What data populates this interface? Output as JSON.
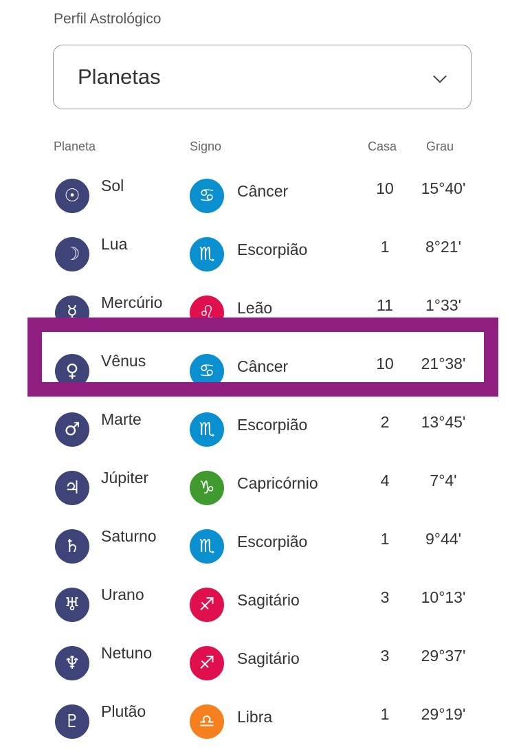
{
  "header": {
    "title": "Perfil Astrológico"
  },
  "dropdown": {
    "selected": "Planetas"
  },
  "columns": {
    "planet": "Planeta",
    "sign": "Signo",
    "house": "Casa",
    "degree": "Grau"
  },
  "highlight": {
    "row_index": 3,
    "color": "#8e1f80"
  },
  "colors": {
    "planet_icon": "#3f4478",
    "water": "#0a8fcf",
    "fire": "#e0104f",
    "earth": "#3f9b2e",
    "air": "#f7801e"
  },
  "rows": [
    {
      "planet": "Sol",
      "planet_icon": "☉",
      "sign": "Câncer",
      "sign_icon": "♋",
      "sign_color": "#0a8fcf",
      "house": "10",
      "degree": "15°40'"
    },
    {
      "planet": "Lua",
      "planet_icon": "☽",
      "sign": "Escorpião",
      "sign_icon": "♏",
      "sign_color": "#0a8fcf",
      "house": "1",
      "degree": "8°21'"
    },
    {
      "planet": "Mercúrio",
      "planet_icon": "☿",
      "sign": "Leão",
      "sign_icon": "♌",
      "sign_color": "#e0104f",
      "house": "11",
      "degree": "1°33'"
    },
    {
      "planet": "Vênus",
      "planet_icon": "♀",
      "sign": "Câncer",
      "sign_icon": "♋",
      "sign_color": "#0a8fcf",
      "house": "10",
      "degree": "21°38'"
    },
    {
      "planet": "Marte",
      "planet_icon": "♂",
      "sign": "Escorpião",
      "sign_icon": "♏",
      "sign_color": "#0a8fcf",
      "house": "2",
      "degree": "13°45'"
    },
    {
      "planet": "Júpiter",
      "planet_icon": "♃",
      "sign": "Capricórnio",
      "sign_icon": "♑",
      "sign_color": "#3f9b2e",
      "house": "4",
      "degree": "7°4'"
    },
    {
      "planet": "Saturno",
      "planet_icon": "♄",
      "sign": "Escorpião",
      "sign_icon": "♏",
      "sign_color": "#0a8fcf",
      "house": "1",
      "degree": "9°44'"
    },
    {
      "planet": "Urano",
      "planet_icon": "♅",
      "sign": "Sagitário",
      "sign_icon": "♐",
      "sign_color": "#e0104f",
      "house": "3",
      "degree": "10°13'"
    },
    {
      "planet": "Netuno",
      "planet_icon": "♆",
      "sign": "Sagitário",
      "sign_icon": "♐",
      "sign_color": "#e0104f",
      "house": "3",
      "degree": "29°37'"
    },
    {
      "planet": "Plutão",
      "planet_icon": "♇",
      "sign": "Libra",
      "sign_icon": "♎",
      "sign_color": "#f7801e",
      "house": "1",
      "degree": "29°19'"
    }
  ]
}
